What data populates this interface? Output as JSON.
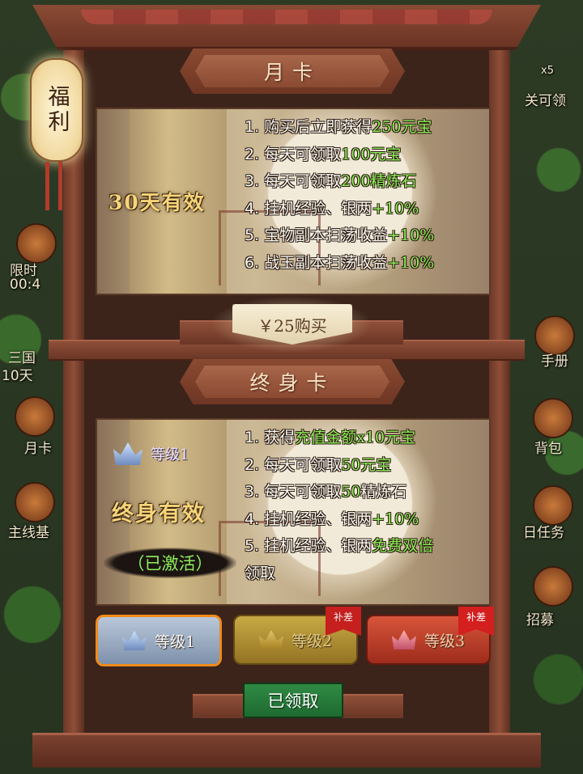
{
  "side": {
    "left_labels": [
      "限时",
      "00:4",
      "三国",
      "10天",
      "月卡",
      "主线基"
    ],
    "right_labels": [
      "x5",
      "关可领",
      "手册",
      "背包",
      "日任务",
      "招募"
    ]
  },
  "lantern": {
    "label": "福利"
  },
  "monthly": {
    "title": "月卡",
    "valid": "30天有效",
    "lines": [
      {
        "num": "1.",
        "text": "购买后立即获得",
        "hl": "250元宝"
      },
      {
        "num": "2.",
        "text": "每天可领取",
        "hl": "100元宝"
      },
      {
        "num": "3.",
        "text": "每天可领取",
        "hl": "200精炼石"
      },
      {
        "num": "4.",
        "text": "挂机经验、银两",
        "hl": "+10%"
      },
      {
        "num": "5.",
        "text": "宝物副本扫荡收益",
        "hl": "+10%"
      },
      {
        "num": "6.",
        "text": "战玉副本扫荡收益",
        "hl": "+10%"
      }
    ],
    "buy_label": "￥25购买"
  },
  "lifetime": {
    "title": "终身卡",
    "level_label": "等级1",
    "valid": "终身有效",
    "status": "（已激活）",
    "lines": [
      {
        "num": "1.",
        "text": "获得",
        "hl": "充值金额x10元宝"
      },
      {
        "num": "2.",
        "text": "每天可领取",
        "hl": "50元宝"
      },
      {
        "num": "3.",
        "text": "每天可领取",
        "hl": "50",
        "tail": "精炼石"
      },
      {
        "num": "4.",
        "text": "挂机经验、银两",
        "hl": "+10%"
      },
      {
        "num": "5.",
        "text": "挂机经验、银两",
        "hl": "免费双倍"
      }
    ],
    "line5_cont": "领取"
  },
  "tabs": [
    {
      "label": "等级1",
      "ribbon": ""
    },
    {
      "label": "等级2",
      "ribbon": "补差"
    },
    {
      "label": "等级3",
      "ribbon": "补差"
    }
  ],
  "claimed_label": "已领取",
  "colors": {
    "highlight": "#8ef05a",
    "valid": "#f6d57a",
    "frame": "#7b4130"
  }
}
